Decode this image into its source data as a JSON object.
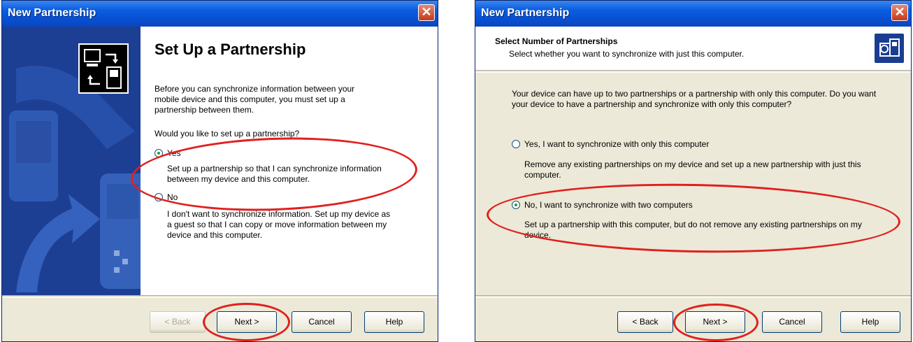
{
  "dialog1": {
    "title": "New Partnership",
    "heading": "Set Up a Partnership",
    "intro": "Before you can synchronize information between your mobile device and this computer, you must set up a partnership between them.",
    "question": "Would you like to set up a partnership?",
    "option_yes": {
      "label": "Yes",
      "desc": "Set up a partnership so that I can synchronize information between my device and this computer.",
      "selected": true
    },
    "option_no": {
      "label": "No",
      "desc": "I don't want to synchronize information. Set up my device as a guest so that I can copy or move information between my device and this computer.",
      "selected": false
    },
    "buttons": {
      "back": "< Back",
      "next": "Next >",
      "cancel": "Cancel",
      "help": "Help"
    }
  },
  "dialog2": {
    "title": "New Partnership",
    "header_title": "Select Number of Partnerships",
    "header_subtitle": "Select whether you want to synchronize with just this computer.",
    "intro": "Your device can have up to two partnerships or a partnership with only this computer. Do you want your device to have a partnership and synchronize with only this computer?",
    "option_one": {
      "label": "Yes, I want to synchronize with only this computer",
      "desc": "Remove any existing partnerships on my device and set up a new partnership with just this computer.",
      "selected": false
    },
    "option_two": {
      "label": "No, I want to synchronize with two computers",
      "desc": "Set up a partnership with this computer, but do not remove any existing partnerships on my device.",
      "selected": true
    },
    "buttons": {
      "back": "< Back",
      "next": "Next >",
      "cancel": "Cancel",
      "help": "Help"
    }
  },
  "colors": {
    "titlebar": "#0a5ee0",
    "annotation": "#e0201e",
    "side_panel": "#1d3f93"
  }
}
